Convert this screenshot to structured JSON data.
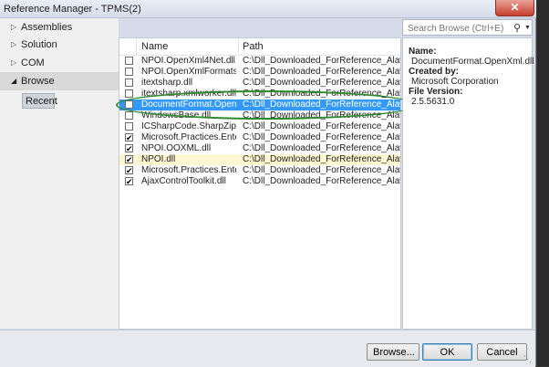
{
  "window": {
    "title": "Reference Manager - TPMS(2)",
    "close_label": "✕"
  },
  "nav": {
    "items": [
      {
        "label": "Assemblies",
        "arrow": "▷"
      },
      {
        "label": "Solution",
        "arrow": "▷"
      },
      {
        "label": "COM",
        "arrow": "▷"
      },
      {
        "label": "Browse",
        "arrow": "◢"
      }
    ],
    "recent_label": "Recent"
  },
  "search": {
    "placeholder": "Search Browse (Ctrl+E)",
    "icon": "search-icon"
  },
  "list": {
    "columns": {
      "name": "Name",
      "path": "Path"
    },
    "rows": [
      {
        "name": "NPOI.OpenXml4Net.dll",
        "path": "C:\\Dll_Downloaded_ForReference_Alaways\\c",
        "checked": false
      },
      {
        "name": "NPOI.OpenXmlFormats....",
        "path": "C:\\Dll_Downloaded_ForReference_Alaways\\c",
        "checked": false
      },
      {
        "name": "itextsharp.dll",
        "path": "C:\\Dll_Downloaded_ForReference_Alaways\\it",
        "checked": false
      },
      {
        "name": "itextsharp.xmlworker.dll",
        "path": "C:\\Dll_Downloaded_ForReference_Alaways\\it",
        "checked": false
      },
      {
        "name": "DocumentFormat.Open...",
        "path": "C:\\Dll_Downloaded_ForReference_Alaways\\",
        "checked": false,
        "selected": true
      },
      {
        "name": "WindowsBase.dll",
        "path": "C:\\Dll_Downloaded_ForReference_Alaways\\",
        "checked": false
      },
      {
        "name": "ICSharpCode.SharpZipLi...",
        "path": "C:\\Dll_Downloaded_ForReference_Alaways\\I",
        "checked": false
      },
      {
        "name": "Microsoft.Practices.Ente...",
        "path": "C:\\Dll_Downloaded_ForReference_Alaways\\M",
        "checked": true
      },
      {
        "name": "NPOI.OOXML.dll",
        "path": "C:\\Dll_Downloaded_ForReference_Alaways\\c",
        "checked": true
      },
      {
        "name": "NPOI.dll",
        "path": "C:\\Dll_Downloaded_ForReference_Alaways\\c",
        "checked": true,
        "highlighted": true
      },
      {
        "name": "Microsoft.Practices.Ente...",
        "path": "C:\\Dll_Downloaded_ForReference_Alaways\\M",
        "checked": true
      },
      {
        "name": "AjaxControlToolkit.dll",
        "path": "C:\\Dll_Downloaded_ForReference_Alaways\\A",
        "checked": true
      }
    ]
  },
  "details": {
    "name_label": "Name:",
    "name_value": "DocumentFormat.OpenXml.dll",
    "created_label": "Created by:",
    "created_value": "Microsoft Corporation",
    "version_label": "File Version:",
    "version_value": "2.5.5631.0"
  },
  "buttons": {
    "browse": "Browse...",
    "ok": "OK",
    "cancel": "Cancel"
  },
  "colors": {
    "selection": "#3399ff",
    "annotation_oval": "#2f8a2f",
    "close": "#c7402f"
  }
}
